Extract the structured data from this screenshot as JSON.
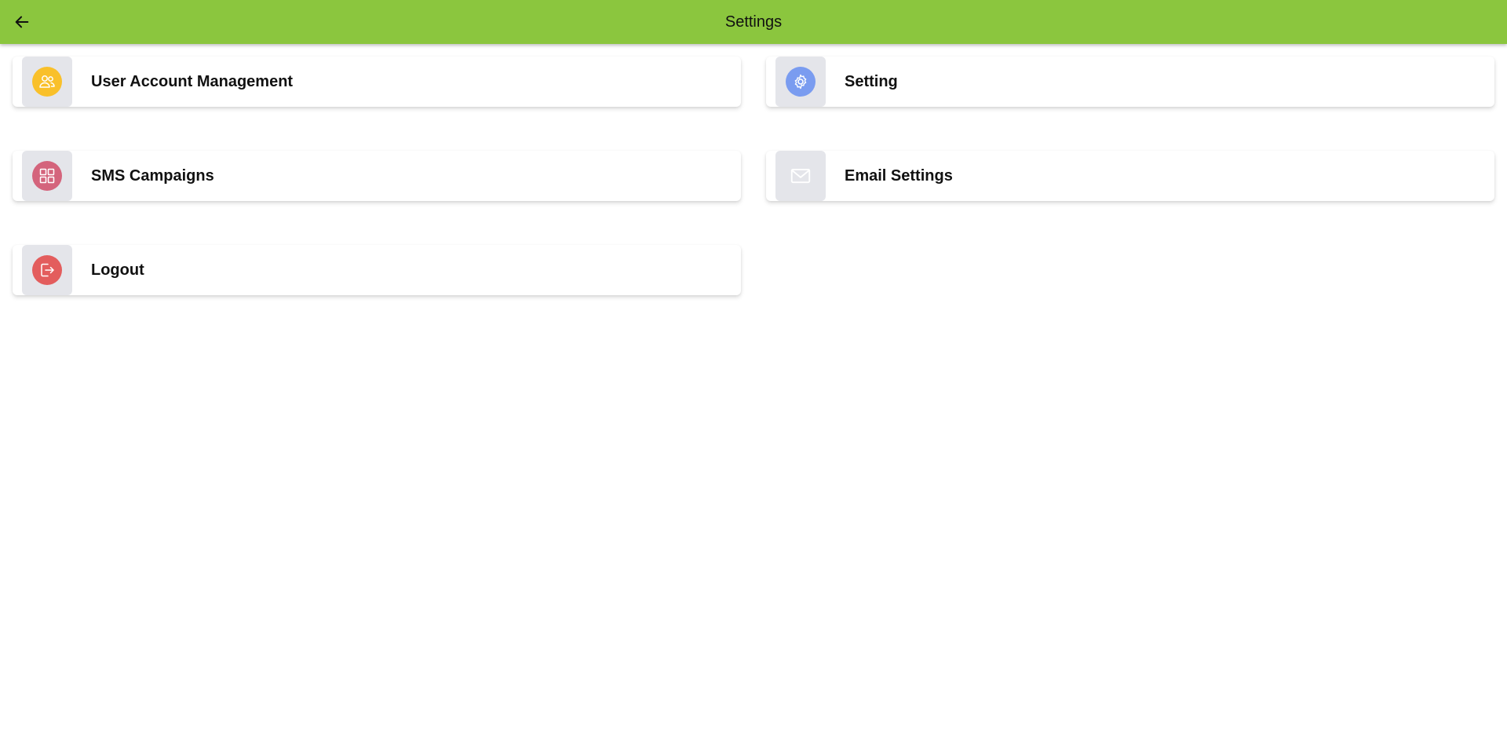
{
  "header": {
    "title": "Settings",
    "back_icon": "arrow-left-icon"
  },
  "cards": [
    {
      "label": "User Account Management",
      "icon": "users-icon",
      "color": "#f9c02a"
    },
    {
      "label": "Setting",
      "icon": "gear-icon",
      "color": "#7a9cf0"
    },
    {
      "label": "SMS Campaigns",
      "icon": "grid-icon",
      "color": "#d4647c"
    },
    {
      "label": "Email Settings",
      "icon": "mail-icon",
      "color": "transparent"
    },
    {
      "label": "Logout",
      "icon": "logout-icon",
      "color": "#e35d5d"
    }
  ],
  "colors": {
    "app_bar": "#8bc63e",
    "icon_tile": "#e4e5ea"
  }
}
